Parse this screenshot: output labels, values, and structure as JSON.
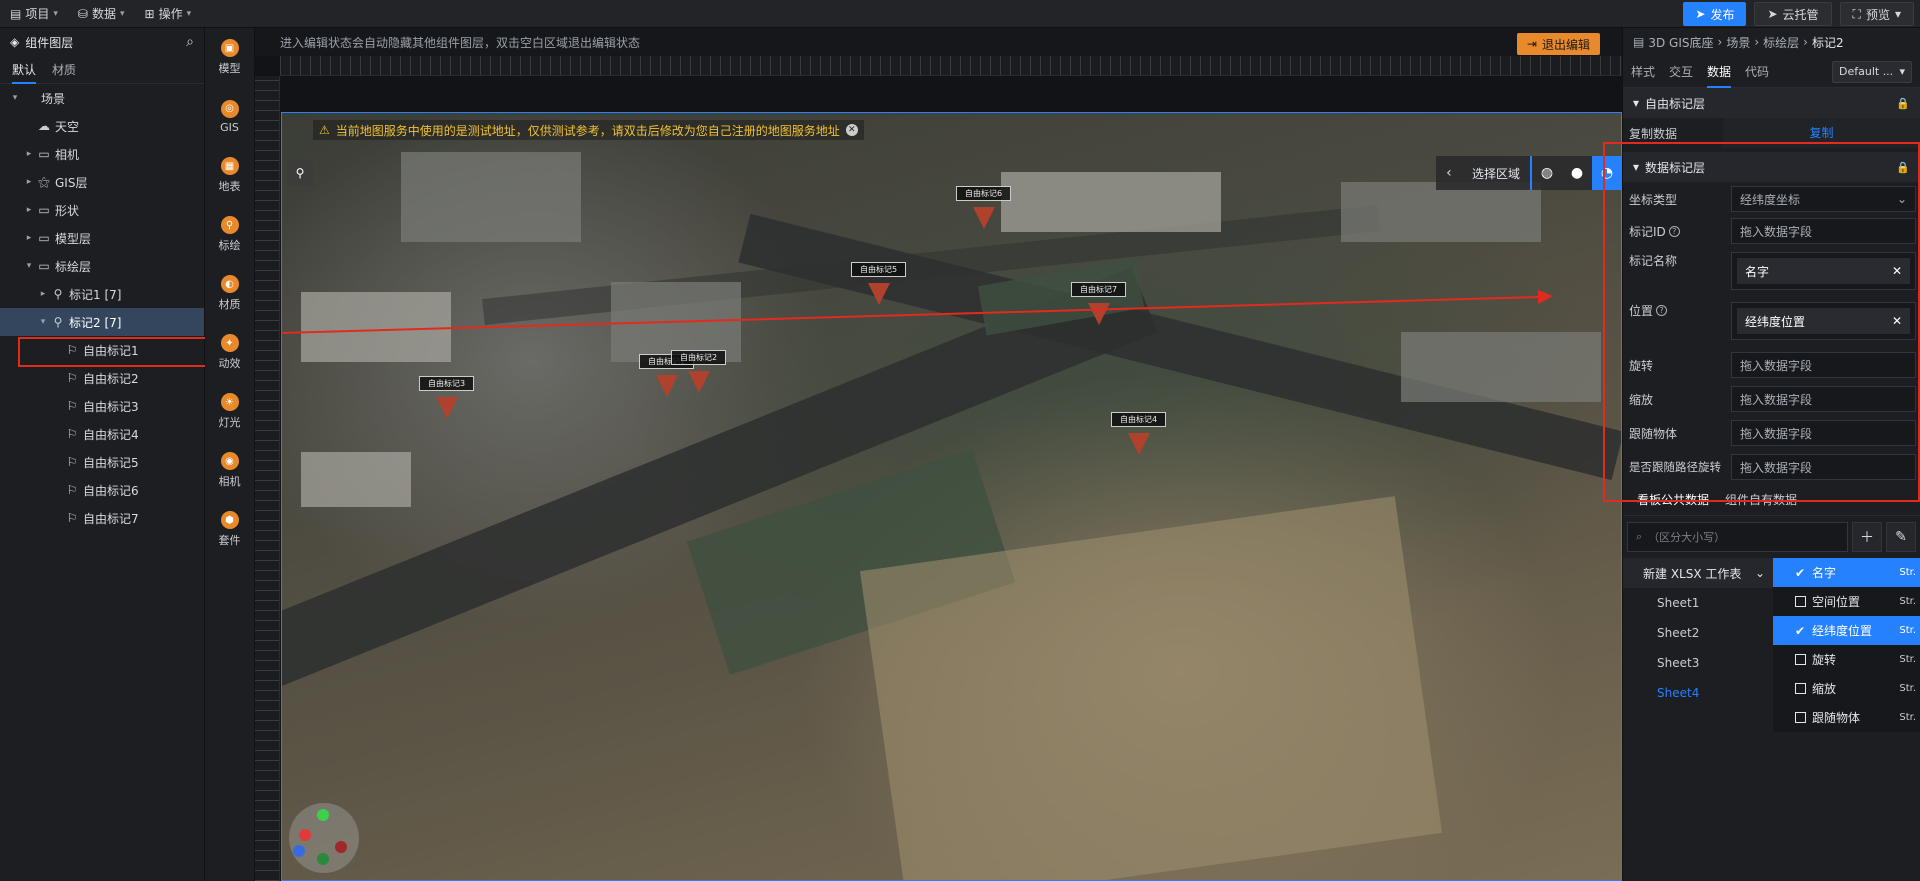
{
  "topbar": {
    "menus": [
      {
        "label": "项目",
        "icon": "file-icon"
      },
      {
        "label": "数据",
        "icon": "database-icon"
      },
      {
        "label": "操作",
        "icon": "grid-icon"
      }
    ],
    "publish": "发布",
    "cloud": "云托管",
    "preview": "预览"
  },
  "left_panel": {
    "title": "组件图层",
    "tabs": [
      "默认",
      "材质"
    ],
    "tree": [
      {
        "label": "场景",
        "level": 0,
        "caret": "down"
      },
      {
        "label": "天空",
        "level": 1,
        "caret": "none"
      },
      {
        "label": "相机",
        "level": 1,
        "caret": "right"
      },
      {
        "label": "GIS层",
        "level": 1,
        "caret": "right"
      },
      {
        "label": "形状",
        "level": 1,
        "caret": "right"
      },
      {
        "label": "模型层",
        "level": 1,
        "caret": "right"
      },
      {
        "label": "标绘层",
        "level": 1,
        "caret": "down"
      },
      {
        "label": "标记1 [7]",
        "level": 2,
        "caret": "right"
      },
      {
        "label": "标记2 [7]",
        "level": 2,
        "caret": "down",
        "selected": true
      },
      {
        "label": "自由标记1",
        "level": 3,
        "caret": "none"
      },
      {
        "label": "自由标记2",
        "level": 3,
        "caret": "none"
      },
      {
        "label": "自由标记3",
        "level": 3,
        "caret": "none"
      },
      {
        "label": "自由标记4",
        "level": 3,
        "caret": "none"
      },
      {
        "label": "自由标记5",
        "level": 3,
        "caret": "none"
      },
      {
        "label": "自由标记6",
        "level": 3,
        "caret": "none"
      },
      {
        "label": "自由标记7",
        "level": 3,
        "caret": "none"
      }
    ]
  },
  "icon_bar": [
    "模型",
    "GIS",
    "地表",
    "标绘",
    "材质",
    "动效",
    "灯光",
    "相机",
    "套件"
  ],
  "canvas": {
    "hint": "进入编辑状态会自动隐藏其他组件图层，双击空白区域退出编辑状态",
    "exit_edit": "退出编辑",
    "warning": "当前地图服务中使用的是测试地址，仅供测试参考，请双击后修改为您自己注册的地图服务地址",
    "select_area": "选择区域",
    "markers": [
      "自由标记3",
      "自由标记1",
      "自由标记2",
      "自由标记5",
      "自由标记7",
      "自由标记4",
      "自由标记6"
    ]
  },
  "right_panel": {
    "breadcrumb": [
      "3D GIS底座",
      "场景",
      "标绘层",
      "标记2"
    ],
    "tabs": [
      "样式",
      "交互",
      "数据",
      "代码"
    ],
    "active_tab": "数据",
    "default_select": "Default ...",
    "sec_free": "自由标记层",
    "copy_label": "复制数据",
    "copy_action": "复制",
    "sec_data": "数据标记层",
    "coord_type_label": "坐标类型",
    "coord_type_value": "经纬度坐标",
    "marker_id_label": "标记ID",
    "marker_name_label": "标记名称",
    "marker_name_value": "名字",
    "position_label": "位置",
    "position_value": "经纬度位置",
    "rotate_label": "旋转",
    "scale_label": "缩放",
    "follow_label": "跟随物体",
    "follow_path_label": "是否跟随路径旋转",
    "drop_placeholder": "拖入数据字段",
    "ds_tabs": [
      "看板公共数据",
      "组件自有数据"
    ],
    "search_placeholder": "（区分大小写）",
    "workbook": "新建 XLSX 工作表",
    "sheets": [
      "Sheet1",
      "Sheet2",
      "Sheet3",
      "Sheet4"
    ],
    "active_sheet": "Sheet4",
    "fields": [
      {
        "name": "名字",
        "type": "Str.",
        "checked": true
      },
      {
        "name": "空间位置",
        "type": "Str.",
        "checked": false
      },
      {
        "name": "经纬度位置",
        "type": "Str.",
        "checked": true
      },
      {
        "name": "旋转",
        "type": "Str.",
        "checked": false
      },
      {
        "name": "缩放",
        "type": "Str.",
        "checked": false
      },
      {
        "name": "跟随物体",
        "type": "Str.",
        "checked": false
      }
    ]
  },
  "colors": {
    "accent": "#2681ff",
    "highlight_box": "#e22a1f",
    "warn": "#f1c232",
    "exit_btn": "#e8892c"
  }
}
